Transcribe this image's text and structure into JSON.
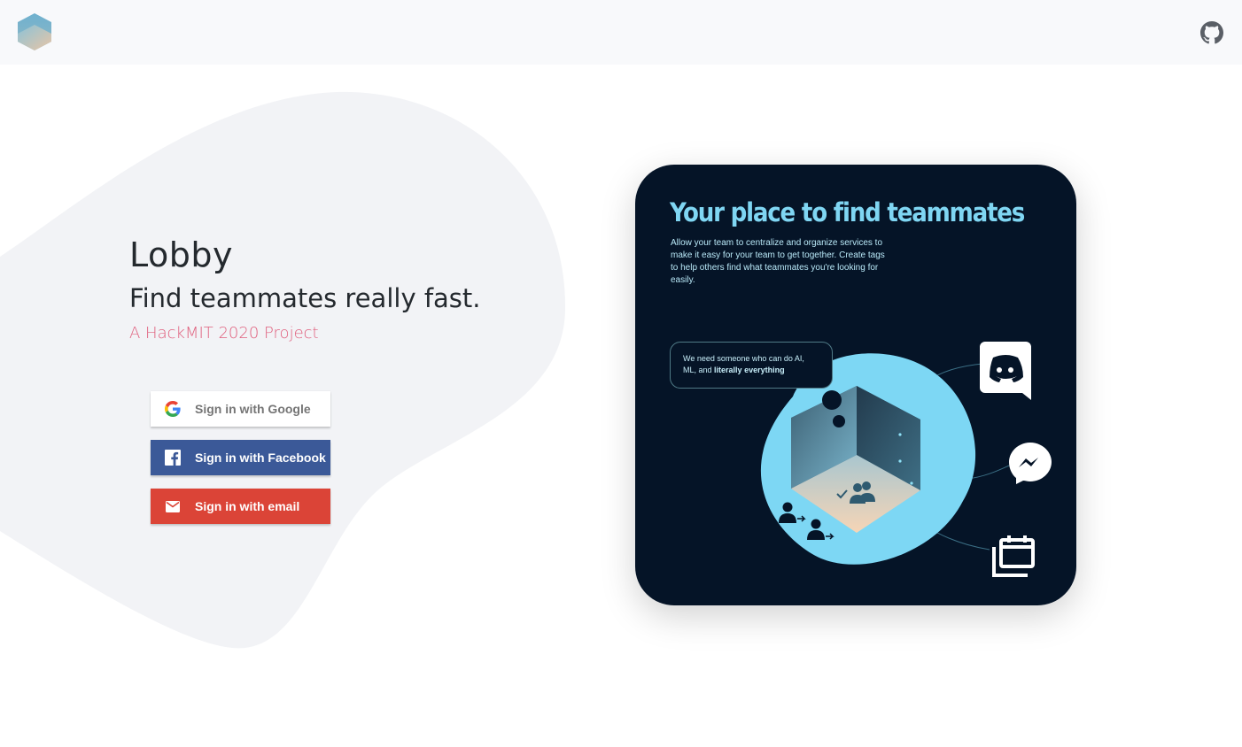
{
  "topbar": {
    "logo_icon": "cube-logo-icon",
    "github_icon": "github-icon"
  },
  "hero": {
    "title": "Lobby",
    "tagline": "Find teammates really fast.",
    "subtitle": "A HackMIT 2020 Project",
    "subtitle_color": "#e0607e"
  },
  "auth": {
    "google_label": "Sign in with Google",
    "facebook_label": "Sign in with Facebook",
    "email_label": "Sign in with email",
    "colors": {
      "google_bg": "#ffffff",
      "facebook_bg": "#3b5998",
      "email_bg": "#db4437"
    }
  },
  "card": {
    "title": "Your place to find teammates",
    "description": "Allow your team to centralize and organize services to make it easy for your team to get together. Create tags to help others find what teammates you're looking for easily.",
    "bubble_text": "We need someone who can do AI, ML, and",
    "bubble_bold": "literally everything",
    "icons": [
      "discord-icon",
      "messenger-icon",
      "calendar-icon",
      "team-icon"
    ],
    "bg_color": "#051427",
    "accent_color": "#7fd6f3"
  }
}
